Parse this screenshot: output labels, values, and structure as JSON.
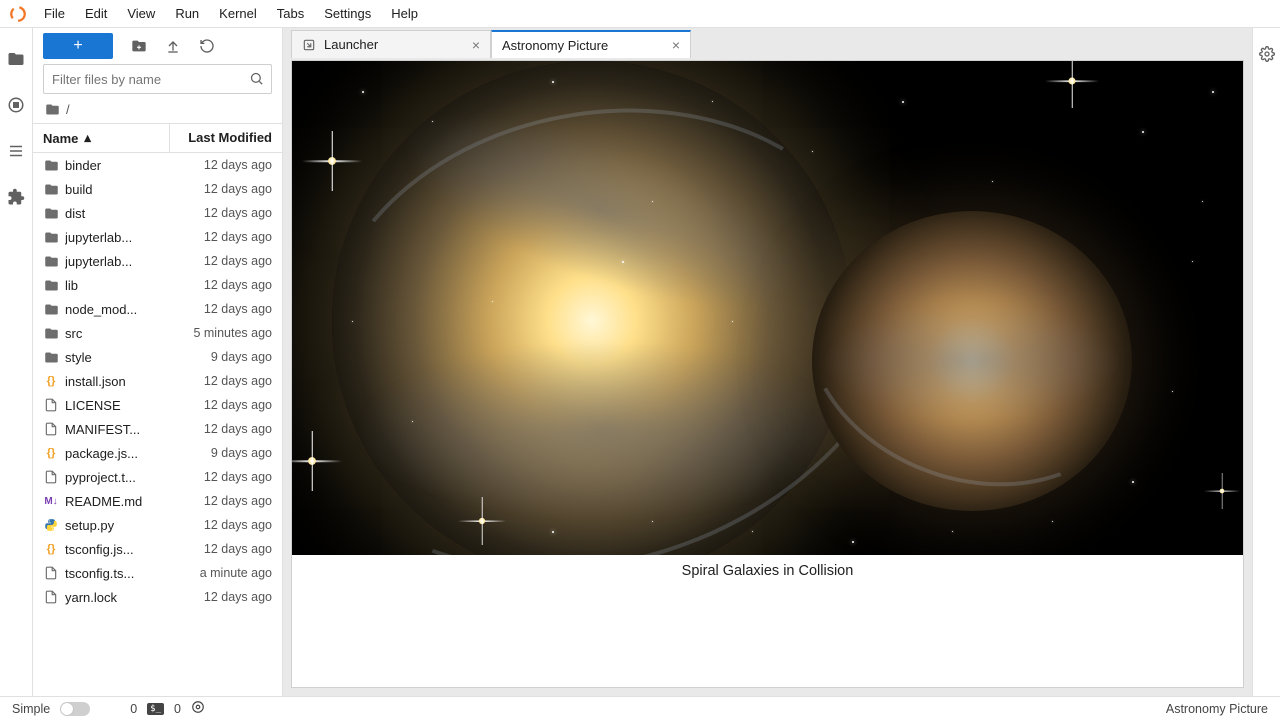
{
  "menu": {
    "items": [
      "File",
      "Edit",
      "View",
      "Run",
      "Kernel",
      "Tabs",
      "Settings",
      "Help"
    ]
  },
  "sidebar": {
    "filter_placeholder": "Filter files by name",
    "breadcrumb_root": "/",
    "columns": {
      "name": "Name",
      "modified": "Last Modified"
    },
    "files": [
      {
        "icon": "folder",
        "name": "binder",
        "modified": "12 days ago"
      },
      {
        "icon": "folder",
        "name": "build",
        "modified": "12 days ago"
      },
      {
        "icon": "folder",
        "name": "dist",
        "modified": "12 days ago"
      },
      {
        "icon": "folder",
        "name": "jupyterlab...",
        "modified": "12 days ago"
      },
      {
        "icon": "folder",
        "name": "jupyterlab...",
        "modified": "12 days ago"
      },
      {
        "icon": "folder",
        "name": "lib",
        "modified": "12 days ago"
      },
      {
        "icon": "folder",
        "name": "node_mod...",
        "modified": "12 days ago"
      },
      {
        "icon": "folder",
        "name": "src",
        "modified": "5 minutes ago"
      },
      {
        "icon": "folder",
        "name": "style",
        "modified": "9 days ago"
      },
      {
        "icon": "json",
        "name": "install.json",
        "modified": "12 days ago"
      },
      {
        "icon": "file",
        "name": "LICENSE",
        "modified": "12 days ago"
      },
      {
        "icon": "file",
        "name": "MANIFEST...",
        "modified": "12 days ago"
      },
      {
        "icon": "json",
        "name": "package.js...",
        "modified": "9 days ago"
      },
      {
        "icon": "file",
        "name": "pyproject.t...",
        "modified": "12 days ago"
      },
      {
        "icon": "md",
        "name": "README.md",
        "modified": "12 days ago"
      },
      {
        "icon": "py",
        "name": "setup.py",
        "modified": "12 days ago"
      },
      {
        "icon": "json",
        "name": "tsconfig.js...",
        "modified": "12 days ago"
      },
      {
        "icon": "file",
        "name": "tsconfig.ts...",
        "modified": "a minute ago"
      },
      {
        "icon": "file",
        "name": "yarn.lock",
        "modified": "12 days ago"
      }
    ]
  },
  "tabs": [
    {
      "label": "Launcher",
      "active": false,
      "icon": "launcher"
    },
    {
      "label": "Astronomy Picture",
      "active": true,
      "icon": "none"
    }
  ],
  "content": {
    "caption": "Spiral Galaxies in Collision"
  },
  "status": {
    "mode_label": "Simple",
    "count_left": "0",
    "count_right": "0",
    "context": "Astronomy Picture"
  }
}
